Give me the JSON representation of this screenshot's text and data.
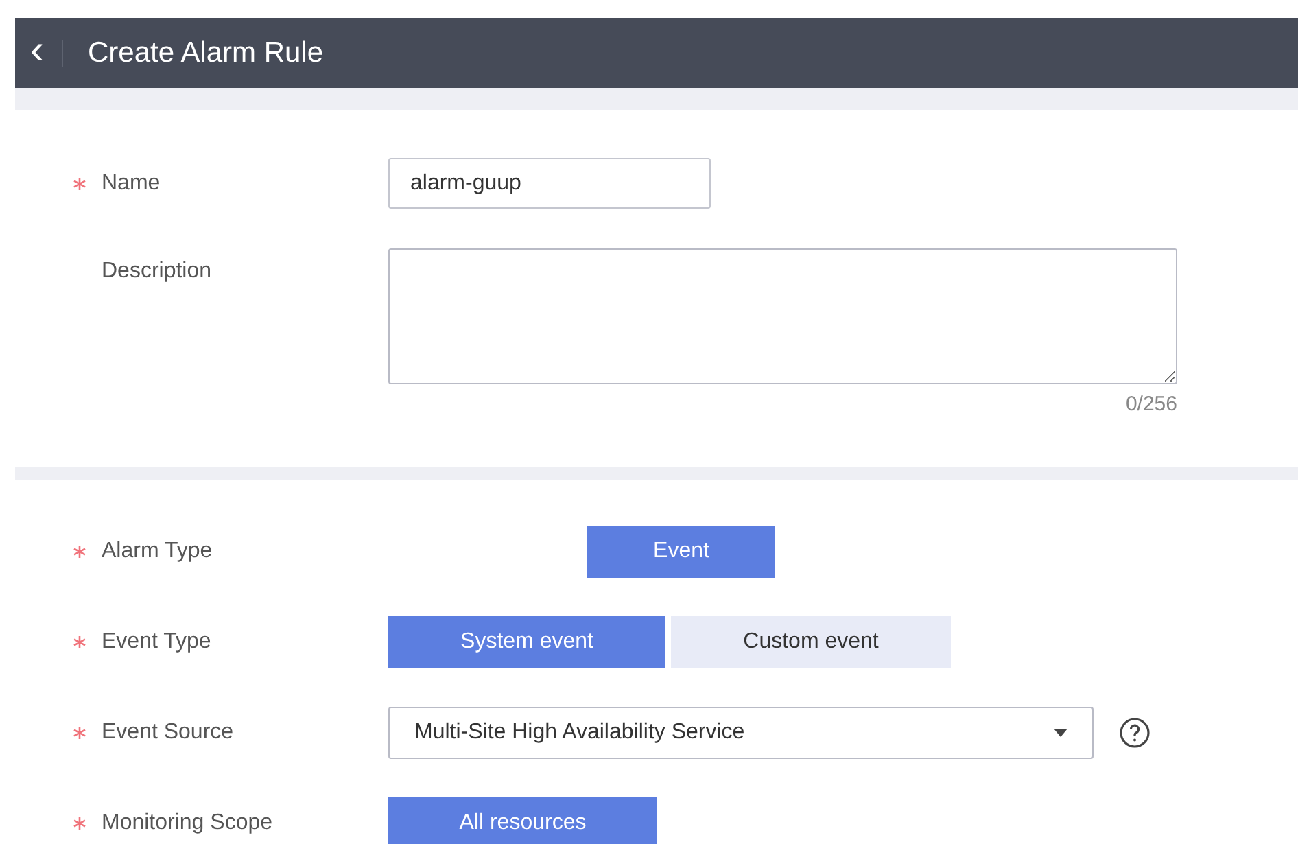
{
  "header": {
    "back_icon": "‹",
    "title": "Create Alarm Rule"
  },
  "basic": {
    "name": {
      "label": "Name",
      "required": true,
      "value": "alarm-guup"
    },
    "description": {
      "label": "Description",
      "required": false,
      "counter": "0/256"
    }
  },
  "settings": [
    {
      "kind": "single",
      "label": "Alarm Type",
      "required": true,
      "options": [
        {
          "label": "Event",
          "selected": true
        }
      ]
    },
    {
      "kind": "segmented",
      "label": "Event Type",
      "required": true,
      "options": [
        {
          "label": "System event",
          "selected": true
        },
        {
          "label": "Custom event",
          "selected": false
        }
      ]
    },
    {
      "kind": "select",
      "label": "Event Source",
      "required": true,
      "value": "Multi-Site High Availability Service"
    },
    {
      "kind": "scope",
      "label": "Monitoring Scope",
      "required": true,
      "options": [
        {
          "label": "All resources",
          "selected": true
        }
      ]
    }
  ]
}
